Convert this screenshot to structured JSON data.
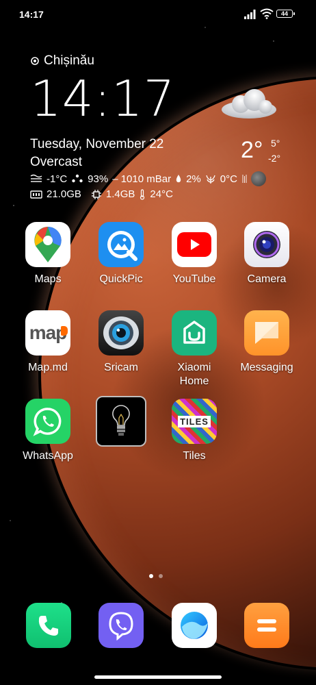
{
  "status_bar": {
    "time": "14:17",
    "battery": "44"
  },
  "widget": {
    "location": "Chișinău",
    "clock": "14:17",
    "date": "Tuesday, November 22",
    "condition": "Overcast",
    "temperature": "2°",
    "temp_high": "5°",
    "temp_low": "-2°",
    "feels_like": "-1°C",
    "humidity": "93%",
    "pressure": "– 1010 mBar",
    "precipitation": "2%",
    "dew_point": "0°C",
    "storage": "21.0GB",
    "ram": "1.4GB",
    "battery_temp": "24°C"
  },
  "apps": [
    {
      "label": "Maps",
      "icon": "google-maps-icon"
    },
    {
      "label": "QuickPic",
      "icon": "quickpic-icon"
    },
    {
      "label": "YouTube",
      "icon": "youtube-icon"
    },
    {
      "label": "Camera",
      "icon": "camera-icon"
    },
    {
      "label": "Map.md",
      "icon": "mapmd-icon",
      "icon_text": "map"
    },
    {
      "label": "Sricam",
      "icon": "sricam-icon"
    },
    {
      "label": "Xiaomi\nHome",
      "icon": "xiaomi-home-icon"
    },
    {
      "label": "Messaging",
      "icon": "messaging-icon"
    },
    {
      "label": "WhatsApp",
      "icon": "whatsapp-icon"
    },
    {
      "label": "",
      "icon": "flashlight-icon"
    },
    {
      "label": "Tiles",
      "icon": "tiles-icon",
      "icon_text": "TILES"
    }
  ],
  "pager": {
    "pages": 2,
    "current": 1
  },
  "dock": [
    {
      "icon": "phone-icon"
    },
    {
      "icon": "viber-icon"
    },
    {
      "icon": "browser-icon"
    },
    {
      "icon": "file-manager-icon"
    }
  ],
  "colors": {
    "maps_bg": "#ffffff",
    "quickpic_bg": "#1e8ff0",
    "youtube_red": "#ff0000",
    "camera_bg": "#ffffff",
    "xiaomi_green": "#1bb57f",
    "messaging_orange": "#ffa63a",
    "whatsapp_green": "#25d366",
    "phone_green": "#18d37c",
    "viber_purple": "#7360f2",
    "file_orange": "#ff8a27"
  }
}
